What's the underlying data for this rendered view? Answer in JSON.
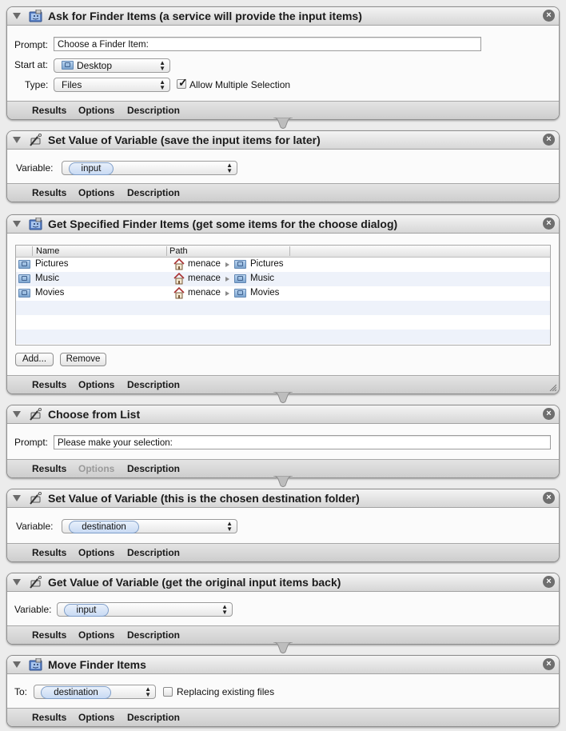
{
  "actions": [
    {
      "title": "Ask for Finder Items (a service will provide the input items)",
      "fields": {
        "prompt_label": "Prompt:",
        "prompt_value": "Choose a Finder Item:",
        "startat_label": "Start at:",
        "startat_value": "Desktop",
        "type_label": "Type:",
        "type_value": "Files",
        "allow_multiple_label": "Allow Multiple Selection",
        "allow_multiple_checked": true
      },
      "footer": [
        "Results",
        "Options",
        "Description"
      ]
    },
    {
      "title": "Set Value of Variable (save the input items for later)",
      "fields": {
        "variable_label": "Variable:",
        "variable_value": "input"
      },
      "footer": [
        "Results",
        "Options",
        "Description"
      ]
    },
    {
      "title": "Get Specified Finder Items (get some items for the choose dialog)",
      "table": {
        "columns": [
          "Name",
          "Path"
        ],
        "rows": [
          {
            "name": "Pictures",
            "path_home": "menace",
            "path_folder": "Pictures"
          },
          {
            "name": "Music",
            "path_home": "menace",
            "path_folder": "Music"
          },
          {
            "name": "Movies",
            "path_home": "menace",
            "path_folder": "Movies"
          }
        ]
      },
      "buttons": {
        "add": "Add...",
        "remove": "Remove"
      },
      "footer": [
        "Results",
        "Options",
        "Description"
      ]
    },
    {
      "title": "Choose from List",
      "fields": {
        "prompt_label": "Prompt:",
        "prompt_value": "Please make your selection:"
      },
      "footer": [
        "Results",
        "Options",
        "Description"
      ],
      "options_disabled": true
    },
    {
      "title": "Set Value of Variable (this is the chosen destination folder)",
      "fields": {
        "variable_label": "Variable:",
        "variable_value": "destination"
      },
      "footer": [
        "Results",
        "Options",
        "Description"
      ]
    },
    {
      "title": "Get Value of Variable (get the original input items back)",
      "fields": {
        "variable_label": "Variable:",
        "variable_value": "input"
      },
      "footer": [
        "Results",
        "Options",
        "Description"
      ]
    },
    {
      "title": "Move Finder Items",
      "fields": {
        "to_label": "To:",
        "to_value": "destination",
        "replacing_label": "Replacing existing files",
        "replacing_checked": false
      },
      "footer": [
        "Results",
        "Options",
        "Description"
      ]
    }
  ],
  "icons": {
    "finder_action": "finder-icon",
    "variable_action": "automator-wand-icon",
    "close": "close-icon",
    "folder": "folder-icon",
    "home": "home-icon"
  },
  "colors": {
    "token_border": "#7f9ec8",
    "row_alt": "#eef2fa",
    "header_bg": "#d6d6d6"
  }
}
